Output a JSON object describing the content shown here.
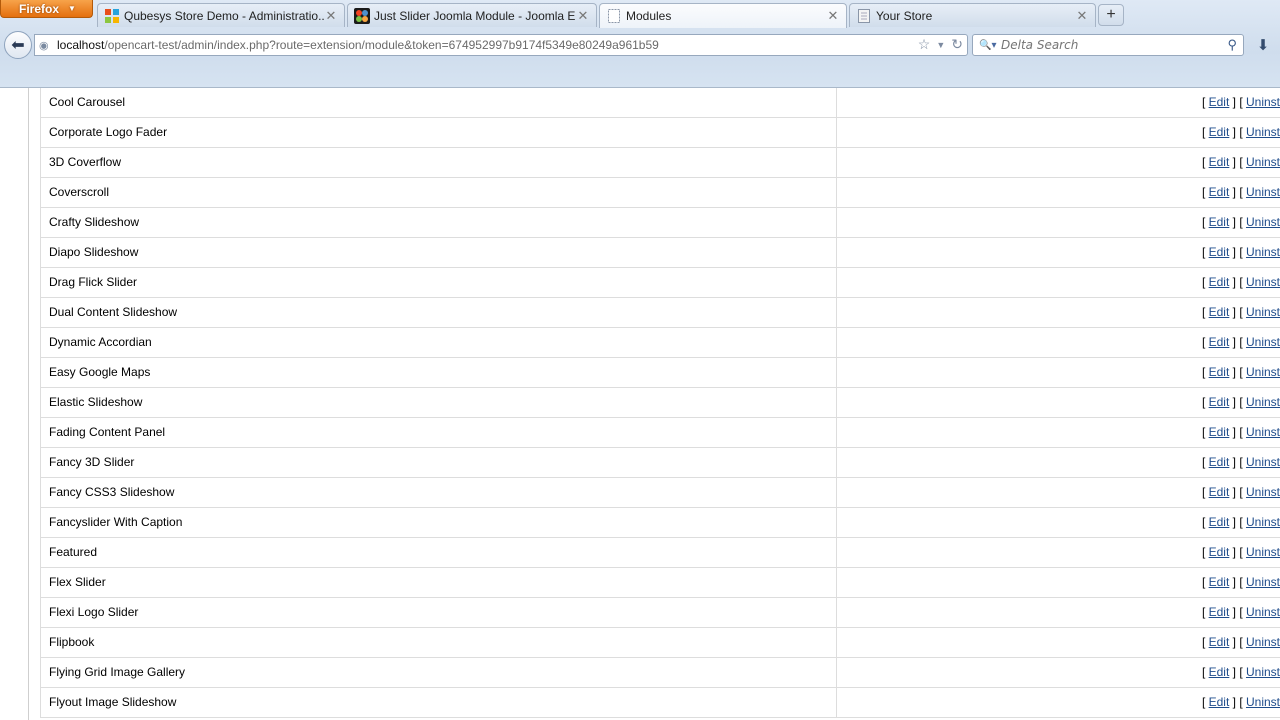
{
  "browser": {
    "menu_button": "Firefox",
    "tabs": [
      {
        "title": "Qubesys Store Demo - Administratio...",
        "favicon": "qubesys-icon",
        "active": false
      },
      {
        "title": "Just Slider Joomla Module - Joomla E...",
        "favicon": "joomla-icon",
        "active": false
      },
      {
        "title": "Modules",
        "favicon": "blank-page-icon",
        "active": true
      },
      {
        "title": "Your Store",
        "favicon": "page-icon",
        "active": false
      }
    ],
    "url_host": "localhost",
    "url_path": "/opencart-test/admin/index.php?route=extension/module&token=674952997b9174f5349e80249a961b59",
    "search_placeholder": "Delta Search"
  },
  "modules": [
    {
      "name": "Cool Carousel"
    },
    {
      "name": "Corporate Logo Fader"
    },
    {
      "name": "3D Coverflow"
    },
    {
      "name": "Coverscroll"
    },
    {
      "name": "Crafty Slideshow"
    },
    {
      "name": "Diapo Slideshow"
    },
    {
      "name": "Drag Flick Slider"
    },
    {
      "name": "Dual Content Slideshow"
    },
    {
      "name": "Dynamic Accordian"
    },
    {
      "name": "Easy Google Maps"
    },
    {
      "name": "Elastic Slideshow"
    },
    {
      "name": "Fading Content Panel"
    },
    {
      "name": "Fancy 3D Slider"
    },
    {
      "name": "Fancy CSS3 Slideshow"
    },
    {
      "name": "Fancyslider With Caption"
    },
    {
      "name": "Featured"
    },
    {
      "name": "Flex Slider"
    },
    {
      "name": "Flexi Logo Slider"
    },
    {
      "name": "Flipbook"
    },
    {
      "name": "Flying Grid Image Gallery"
    },
    {
      "name": "Flyout Image Slideshow"
    }
  ],
  "actions": {
    "open_bracket": "[ ",
    "edit_label": "Edit",
    "separator": " ] [ ",
    "uninstall_label": "Uninst"
  }
}
